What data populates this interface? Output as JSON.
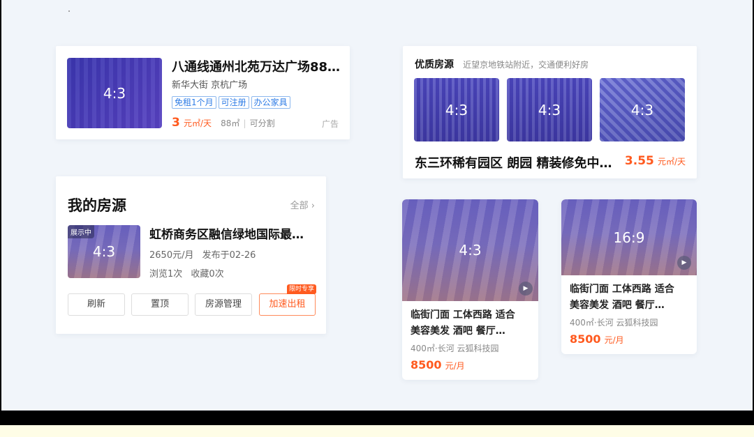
{
  "ad_listing": {
    "ratio": "4:3",
    "title": "八通线通州北苑万达广场88…",
    "location": "新华大街  京杭广场",
    "tags": [
      "免租1个月",
      "可注册",
      "办公家具"
    ],
    "price": "3",
    "price_unit": "元㎡/天",
    "area": "88㎡",
    "divisible": "可分割",
    "ad_label": "广告"
  },
  "quality": {
    "title": "优质房源",
    "subtitle": "近望京地铁站附近，交通便利好房",
    "images": [
      {
        "ratio": "4:3"
      },
      {
        "ratio": "4:3"
      },
      {
        "ratio": "4:3"
      }
    ],
    "listing_title": "东三环稀有园区 朗园 精装修免中…",
    "price": "3.55",
    "price_unit": "元㎡/天"
  },
  "my_listings": {
    "title": "我的房源",
    "all_label": "全部",
    "ratio": "4:3",
    "status": "展示中",
    "listing_title": "虹桥商务区融信绿地国际最…",
    "rent": "2650元/月",
    "published": "发布于02-26",
    "views": "浏览1次",
    "favorites": "收藏0次",
    "buttons": [
      "刷新",
      "置顶",
      "房源管理",
      "加速出租"
    ],
    "hot_badge": "限时专享"
  },
  "video_cards": [
    {
      "ratio": "4:3",
      "title_line1": "临街门面 工体西路 适合",
      "title_line2": "美容美发 酒吧 餐厅…",
      "meta": "400㎡·长河  云狐科技园",
      "price": "8500",
      "price_unit": "元/月"
    },
    {
      "ratio": "16:9",
      "title_line1": "临街门面 工体西路 适合",
      "title_line2": "美容美发 酒吧 餐厅…",
      "meta": "400㎡·长河  云狐科技园",
      "price": "8500",
      "price_unit": "元/月"
    }
  ],
  "icons": {
    "chevron": "›",
    "play": "▶"
  },
  "colors": {
    "accent": "#ff5a1f",
    "tag_blue": "#2e7ce6",
    "background": "#f1f5fa"
  }
}
